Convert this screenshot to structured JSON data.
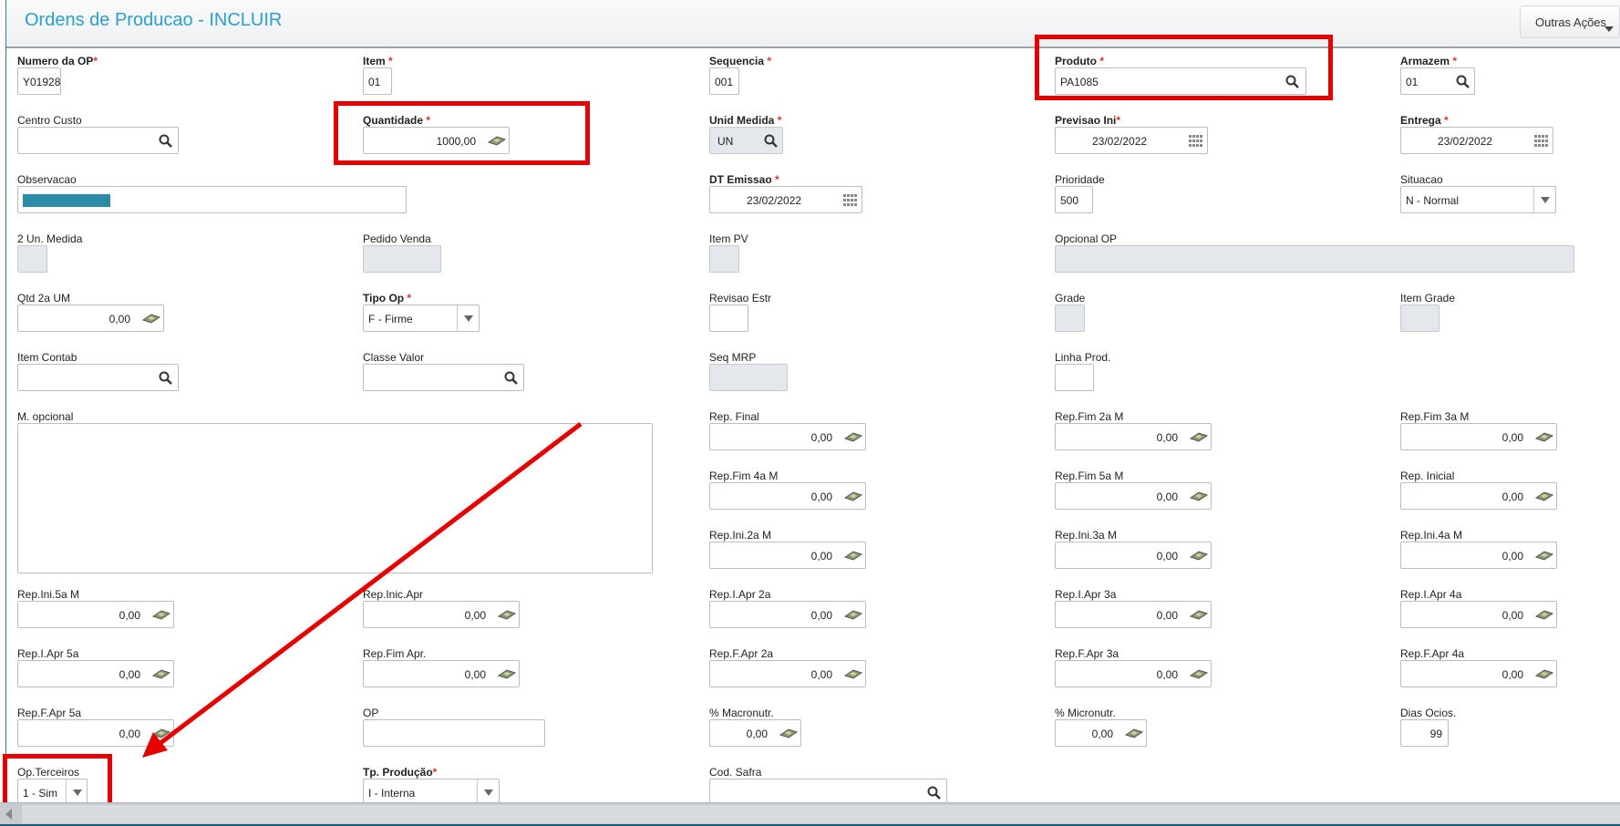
{
  "header": {
    "title": "Ordens de Producao - INCLUIR",
    "actions_label": "Outras Ações"
  },
  "fields": {
    "numero_op": {
      "label": "Numero da OP",
      "req": "*",
      "value": "Y01928"
    },
    "item": {
      "label": "Item",
      "req": "*",
      "value": "01"
    },
    "sequencia": {
      "label": "Sequencia",
      "req": "*",
      "value": "001"
    },
    "produto": {
      "label": "Produto",
      "req": "*",
      "value": "PA1085"
    },
    "armazem": {
      "label": "Armazem",
      "req": "*",
      "value": "01"
    },
    "centro_custo": {
      "label": "Centro Custo",
      "value": ""
    },
    "quantidade": {
      "label": "Quantidade",
      "req": "*",
      "value": "1000,00"
    },
    "unid_medida": {
      "label": "Unid Medida",
      "req": "*",
      "value": "UN"
    },
    "previsao_ini": {
      "label": "Previsao Ini",
      "req": "*",
      "value": "23/02/2022"
    },
    "entrega": {
      "label": "Entrega",
      "req": "*",
      "value": "23/02/2022"
    },
    "observacao": {
      "label": "Observacao"
    },
    "dt_emissao": {
      "label": "DT Emissao",
      "req": "*",
      "value": "23/02/2022"
    },
    "prioridade": {
      "label": "Prioridade",
      "value": "500"
    },
    "situacao": {
      "label": "Situacao",
      "value": "N - Normal"
    },
    "un2_medida": {
      "label": "2 Un. Medida"
    },
    "pedido_venda": {
      "label": "Pedido Venda"
    },
    "item_pv": {
      "label": "Item PV"
    },
    "opcional_op": {
      "label": "Opcional OP"
    },
    "qtd_2a_um": {
      "label": "Qtd 2a UM",
      "value": "0,00"
    },
    "tipo_op": {
      "label": "Tipo Op",
      "req": "*",
      "value": "F - Firme"
    },
    "revisao_estr": {
      "label": "Revisao Estr"
    },
    "grade": {
      "label": "Grade"
    },
    "item_grade": {
      "label": "Item Grade"
    },
    "item_contab": {
      "label": "Item Contab"
    },
    "classe_valor": {
      "label": "Classe Valor"
    },
    "seq_mrp": {
      "label": "Seq MRP"
    },
    "linha_prod": {
      "label": "Linha Prod."
    },
    "m_opcional": {
      "label": "M. opcional"
    },
    "rep_final": {
      "label": "Rep. Final",
      "value": "0,00"
    },
    "rep_fim_2a": {
      "label": "Rep.Fim 2a M",
      "value": "0,00"
    },
    "rep_fim_3a": {
      "label": "Rep.Fim 3a M",
      "value": "0,00"
    },
    "rep_fim_4a": {
      "label": "Rep.Fim 4a M",
      "value": "0,00"
    },
    "rep_fim_5a": {
      "label": "Rep.Fim 5a M",
      "value": "0,00"
    },
    "rep_inicial": {
      "label": "Rep. Inicial",
      "value": "0,00"
    },
    "rep_ini_2a": {
      "label": "Rep.Ini.2a M",
      "value": "0,00"
    },
    "rep_ini_3a": {
      "label": "Rep.Ini.3a M",
      "value": "0,00"
    },
    "rep_ini_4a": {
      "label": "Rep.Ini.4a M",
      "value": "0,00"
    },
    "rep_ini_5a": {
      "label": "Rep.Ini.5a M",
      "value": "0,00"
    },
    "rep_inic_apr": {
      "label": "Rep.Inic.Apr",
      "value": "0,00"
    },
    "rep_i_apr_2a": {
      "label": "Rep.I.Apr 2a",
      "value": "0,00"
    },
    "rep_i_apr_3a": {
      "label": "Rep.I.Apr 3a",
      "value": "0,00"
    },
    "rep_i_apr_4a": {
      "label": "Rep.I.Apr 4a",
      "value": "0,00"
    },
    "rep_i_apr_5a": {
      "label": "Rep.I.Apr 5a",
      "value": "0,00"
    },
    "rep_fim_apr": {
      "label": "Rep.Fim Apr.",
      "value": "0,00"
    },
    "rep_f_apr_2a": {
      "label": "Rep.F.Apr 2a",
      "value": "0,00"
    },
    "rep_f_apr_3a": {
      "label": "Rep.F.Apr 3a",
      "value": "0,00"
    },
    "rep_f_apr_4a": {
      "label": "Rep.F.Apr 4a",
      "value": "0,00"
    },
    "rep_f_apr_5a": {
      "label": "Rep.F.Apr 5a",
      "value": "0,00"
    },
    "op": {
      "label": "OP",
      "value": ""
    },
    "macronutr": {
      "label": "% Macronutr.",
      "value": "0,00"
    },
    "micronutr": {
      "label": "% Micronutr.",
      "value": "0,00"
    },
    "dias_ocios": {
      "label": "Dias Ocios.",
      "value": "99"
    },
    "op_terceiros": {
      "label": "Op.Terceiros",
      "value": "1 - Sim"
    },
    "tp_producao": {
      "label": "Tp. Produção",
      "req": "*",
      "value": "I - Interna"
    },
    "cod_safra": {
      "label": "Cod. Safra",
      "value": ""
    }
  },
  "colors": {
    "title": "#2c9fcf",
    "required": "#dd3333",
    "annotation": "#e60000",
    "observacao_fill": "#2b8ca8"
  }
}
